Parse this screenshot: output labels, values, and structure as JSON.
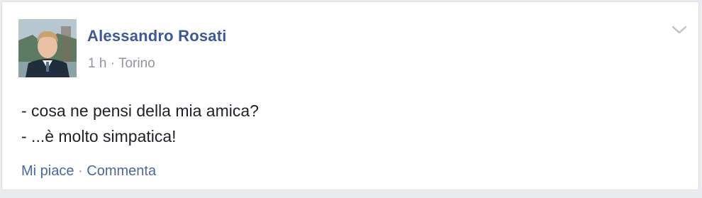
{
  "post": {
    "author": "Alessandro Rosati",
    "time": "1 h",
    "separator": " · ",
    "location": "Torino",
    "lines": [
      "- cosa ne pensi della mia amica?",
      "- ...è molto simpatica!"
    ],
    "actions": {
      "like": "Mi piace",
      "separator": " · ",
      "comment": "Commenta"
    }
  },
  "icons": {
    "options": "chevron-down-icon",
    "avatar": "profile-photo"
  },
  "colors": {
    "author": "#3b5998",
    "meta": "#90949c",
    "action_link": "#4b67a1",
    "text": "#1d2129",
    "background": "#e9ebee",
    "card": "#ffffff"
  }
}
